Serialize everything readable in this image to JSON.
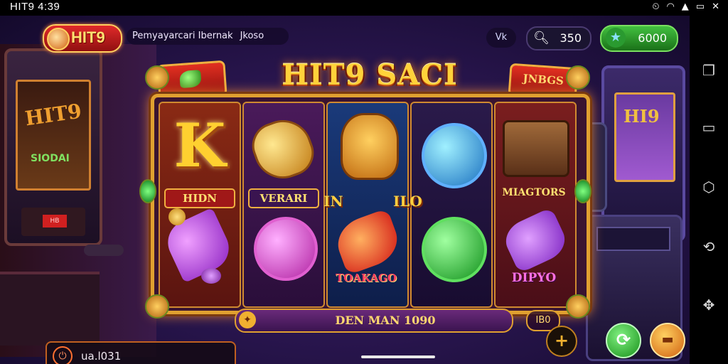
{
  "status_bar": {
    "time": "HIT9 4:39"
  },
  "header": {
    "logo_text": "HIT9",
    "marquee_text": "Pemyayarcari Ibernak",
    "marquee_extra": "Jkoso",
    "vip_label": "Vk",
    "search_value": "350",
    "coins_value": "6000"
  },
  "game": {
    "title": "HIT9 SACI",
    "badge_right": "JNBGS",
    "reels": [
      {
        "top_label": "HIDN"
      },
      {
        "top_label": "VERARI"
      },
      {
        "top_label": "",
        "bottom_label": "TOAKAGO"
      },
      {
        "top_label": ""
      },
      {
        "top_label": "MIAGTORS",
        "bottom_label": "DIPYO"
      }
    ],
    "mid_left": "IN",
    "mid_right": "ILO",
    "win_line": "DEN MAN 1090",
    "line_count": "IB0"
  },
  "bottom": {
    "balance_text": "ua.l031"
  },
  "background": {
    "left_cabinet_text": "HIT9",
    "left_cabinet_sub": "SIODAI",
    "left_cabinet_panel": "HB",
    "right_cabinet_text": "HI9"
  },
  "colors": {
    "accent_gold": "#ffd23a",
    "brand_red": "#e02a2a",
    "coins_green": "#42c040"
  }
}
